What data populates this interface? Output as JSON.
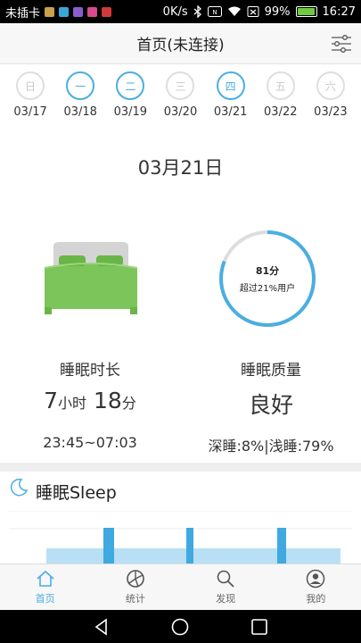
{
  "status_bar": {
    "carrier": "未插卡",
    "speed": "0K/s",
    "battery_text": "99%",
    "battery_level": 0.99,
    "time": "16:27"
  },
  "header": {
    "title": "首页(未连接)"
  },
  "week": [
    {
      "weekday": "日",
      "date": "03/17",
      "done": false
    },
    {
      "weekday": "一",
      "date": "03/18",
      "done": true
    },
    {
      "weekday": "二",
      "date": "03/19",
      "done": true
    },
    {
      "weekday": "三",
      "date": "03/20",
      "done": false
    },
    {
      "weekday": "四",
      "date": "03/21",
      "done": true
    },
    {
      "weekday": "五",
      "date": "03/22",
      "done": false
    },
    {
      "weekday": "六",
      "date": "03/23",
      "done": false
    }
  ],
  "selected_date": "03月21日",
  "quality_ring": {
    "score": "81分",
    "subtitle": "超过21%用户",
    "progress": 0.81,
    "color": "#4aaee2"
  },
  "duration": {
    "label": "睡眠时长",
    "hours": "7",
    "hours_unit": "小时",
    "minutes": "18",
    "minutes_unit": "分",
    "range": "23:45~07:03"
  },
  "quality": {
    "label": "睡眠质量",
    "value": "良好",
    "breakdown": "深睡:8%|浅睡:79%"
  },
  "sleep_section": {
    "title": "睡眠Sleep"
  },
  "nav": [
    {
      "label": "首页",
      "icon": "home-icon",
      "active": true
    },
    {
      "label": "统计",
      "icon": "stats-icon",
      "active": false
    },
    {
      "label": "发现",
      "icon": "discover-icon",
      "active": false
    },
    {
      "label": "我的",
      "icon": "profile-icon",
      "active": false
    }
  ],
  "colors": {
    "accent": "#4aaee2",
    "bed_green": "#7cc55a",
    "ring_track": "#dddddd"
  }
}
